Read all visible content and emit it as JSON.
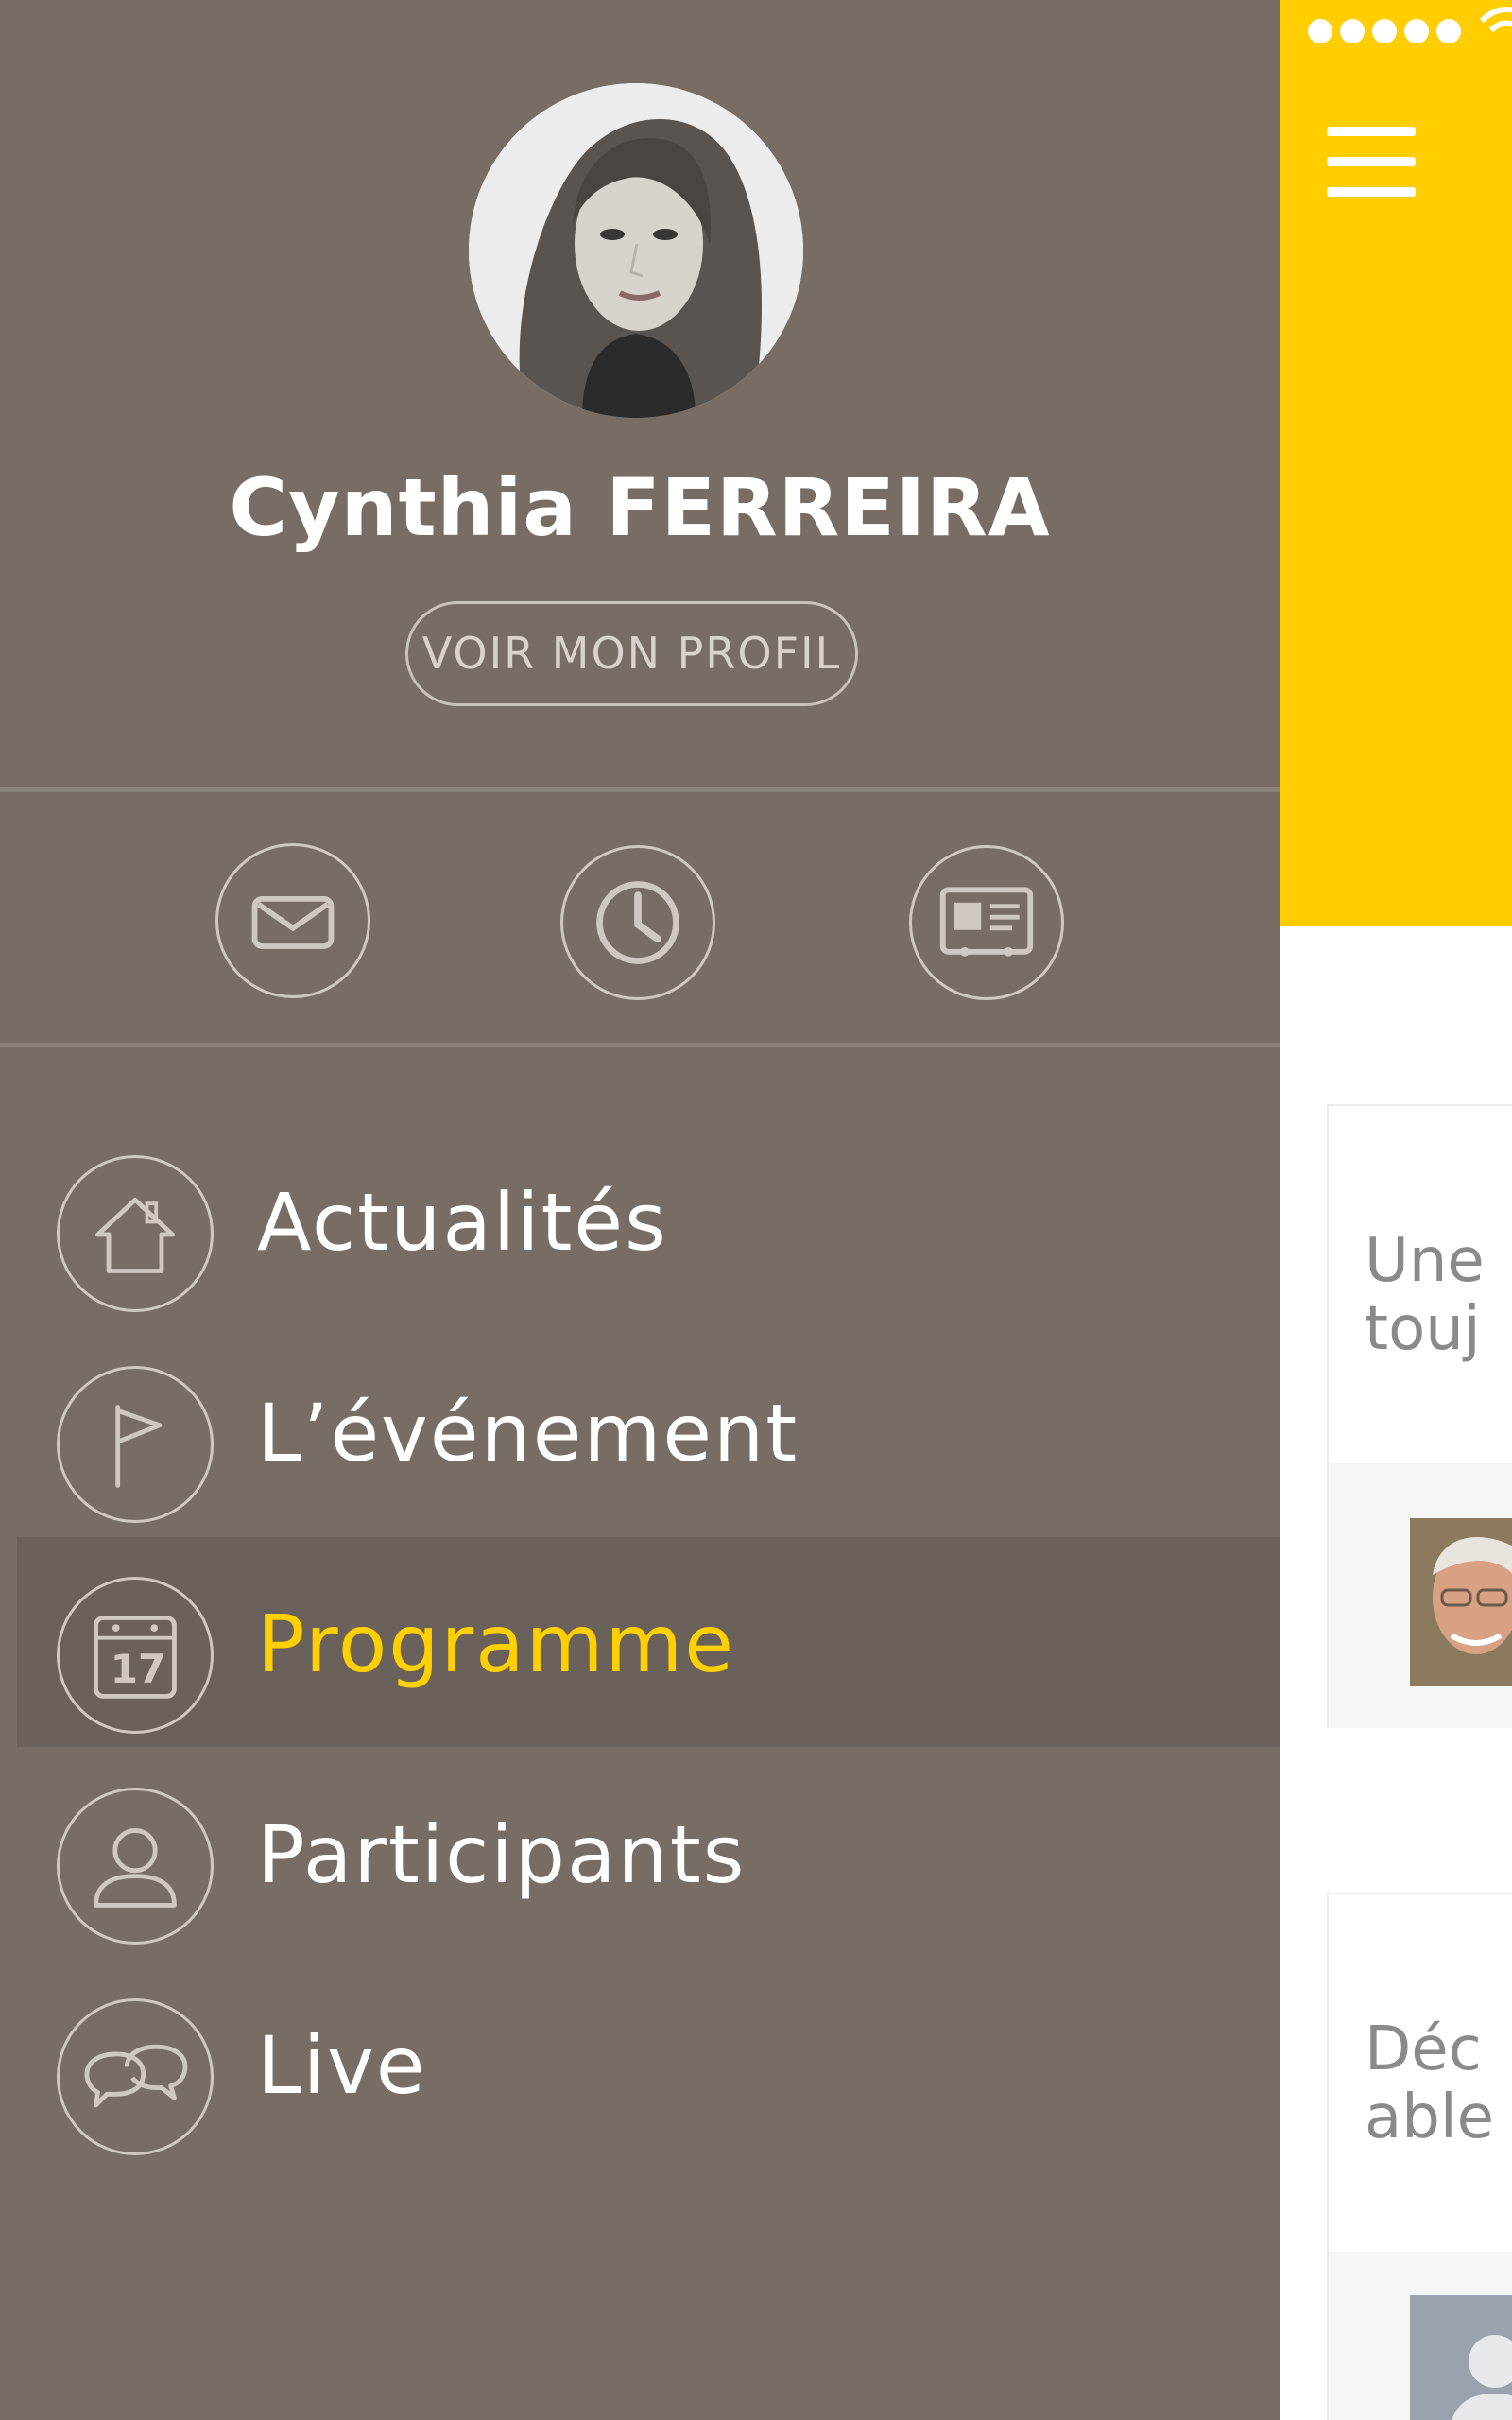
{
  "profile": {
    "name": "Cynthia FERREIRA",
    "view_profile_label": "VOIR MON PROFIL"
  },
  "quick_actions": [
    {
      "icon": "envelope-icon"
    },
    {
      "icon": "clock-icon"
    },
    {
      "icon": "id-card-icon"
    }
  ],
  "menu": {
    "items": [
      {
        "label": "Actualités",
        "icon": "house-icon",
        "active": false
      },
      {
        "label": "L’événement",
        "icon": "flag-icon",
        "active": false
      },
      {
        "label": "Programme",
        "icon": "calendar-icon",
        "calendar_day": "17",
        "active": true
      },
      {
        "label": "Participants",
        "icon": "person-icon",
        "active": false
      },
      {
        "label": "Live",
        "icon": "chat-bubbles-icon",
        "active": false
      }
    ]
  },
  "main": {
    "cards": [
      {
        "line1": "Une",
        "line2": "touj"
      },
      {
        "line1": "Déc",
        "line2": "able"
      }
    ]
  },
  "colors": {
    "drawer_bg": "#776d64",
    "active_bg": "#6a625a",
    "accent_yellow": "#ffcd00",
    "active_text": "#ffd000"
  }
}
